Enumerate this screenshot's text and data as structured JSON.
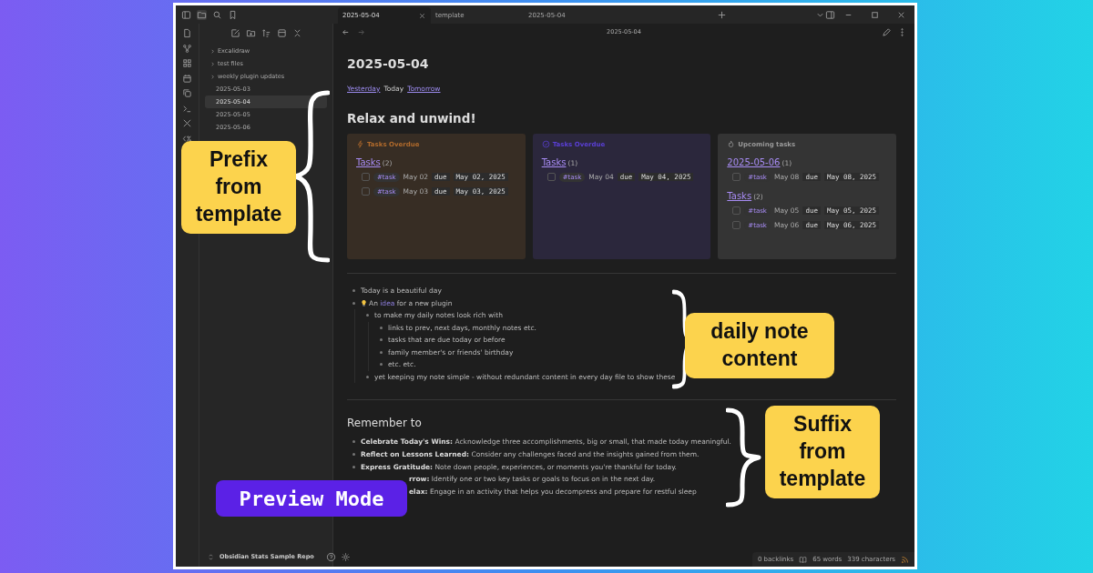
{
  "top_bar": {
    "tabs": [
      {
        "label": "2025-05-04",
        "selected": true
      },
      {
        "label": "template",
        "selected": false
      },
      {
        "label": "2025-05-04",
        "selected": false
      }
    ]
  },
  "sidebar": {
    "items": [
      {
        "label": "Excalidraw",
        "kind": "folder",
        "selected": false
      },
      {
        "label": "test files",
        "kind": "folder",
        "selected": false
      },
      {
        "label": "weekly plugin updates",
        "kind": "folder",
        "selected": false
      },
      {
        "label": "2025-05-03",
        "kind": "file",
        "selected": false
      },
      {
        "label": "2025-05-04",
        "kind": "file",
        "selected": true
      },
      {
        "label": "2025-05-05",
        "kind": "file",
        "selected": false
      },
      {
        "label": "2025-05-06",
        "kind": "file",
        "selected": false
      }
    ],
    "vault": "Obsidian Stats Sample Repo"
  },
  "note": {
    "header": "2025-05-04",
    "title": "2025-05-04",
    "nav_links": [
      {
        "label": "Yesterday",
        "kind": "link"
      },
      {
        "label": "Today",
        "kind": "text"
      },
      {
        "label": "Tomorrow",
        "kind": "link"
      }
    ],
    "heading": "Relax and unwind!",
    "cards": [
      {
        "kind": "overdue",
        "title": "Tasks Overdue",
        "color": "#b06a2c",
        "groups": [
          {
            "link": "Tasks",
            "count": "(2)",
            "tasks": [
              {
                "checked": false,
                "tag": "#task",
                "text": "May 02",
                "due": "due",
                "date": "May 02, 2025"
              },
              {
                "checked": false,
                "tag": "#task",
                "text": "May 03",
                "due": "due",
                "date": "May 03, 2025"
              }
            ]
          }
        ]
      },
      {
        "kind": "todo",
        "title": "Tasks Overdue",
        "color": "#5a3fd6",
        "groups": [
          {
            "link": "Tasks",
            "count": "(1)",
            "tasks": [
              {
                "checked": false,
                "tag": "#task",
                "text": "May 04",
                "due": "due",
                "date": "May 04, 2025"
              }
            ]
          }
        ]
      },
      {
        "kind": "upcoming",
        "title": "Upcoming tasks",
        "color": "#9a9a9a",
        "groups": [
          {
            "link": "2025-05-06",
            "count": "(1)",
            "tasks": [
              {
                "checked": false,
                "tag": "#task",
                "text": "May 08",
                "due": "due",
                "date": "May 08, 2025"
              }
            ]
          },
          {
            "link": "Tasks",
            "count": "(2)",
            "tasks": [
              {
                "checked": false,
                "tag": "#task",
                "text": "May 05",
                "due": "due",
                "date": "May 05, 2025"
              },
              {
                "checked": false,
                "tag": "#task",
                "text": "May 06",
                "due": "due",
                "date": "May 06, 2025"
              }
            ]
          }
        ]
      }
    ],
    "bullets": [
      {
        "kind": "plain",
        "parts": [
          {
            "kind": "text",
            "text": "Today is a beautiful day"
          }
        ]
      },
      {
        "kind": "idea",
        "parts": [
          {
            "kind": "text",
            "text": "An "
          },
          {
            "kind": "link",
            "text": "idea"
          },
          {
            "kind": "text",
            "text": " for a new plugin"
          }
        ],
        "children": [
          {
            "parts": [
              {
                "kind": "text",
                "text": "to make my daily notes look rich with"
              }
            ],
            "children": [
              {
                "parts": [
                  {
                    "kind": "text",
                    "text": "links to prev, next days, monthly notes etc."
                  }
                ]
              },
              {
                "parts": [
                  {
                    "kind": "text",
                    "text": "tasks that are due today or before"
                  }
                ]
              },
              {
                "parts": [
                  {
                    "kind": "text",
                    "text": "family member's or friends' birthday"
                  }
                ]
              },
              {
                "parts": [
                  {
                    "kind": "text",
                    "text": "etc. etc."
                  }
                ]
              }
            ]
          },
          {
            "parts": [
              {
                "kind": "text",
                "text": "yet keeping my note simple - without redundant content in every day file to show these"
              }
            ]
          }
        ]
      }
    ],
    "suffix_heading": "Remember to",
    "suffix_items": [
      "**Celebrate Today's Wins:** Acknowledge three accomplishments, big or small, that made today meaningful.",
      "**Reflect on Lessons Learned:** Consider any challenges faced and the insights gained from them.",
      "**Express Gratitude:** Note down people, experiences, or moments you're thankful for today.",
      "**rrow:** Identify one or two key tasks or goals to focus on in the next day.",
      "**elax:** Engage in an activity that helps you decompress and prepare for restful sleep"
    ]
  },
  "status_bar": {
    "backlinks": "0 backlinks",
    "words": "65 words",
    "characters": "339 characters"
  },
  "callouts": [
    "Prefix from template",
    "daily note content",
    "Suffix from template"
  ],
  "badge": "Preview Mode"
}
